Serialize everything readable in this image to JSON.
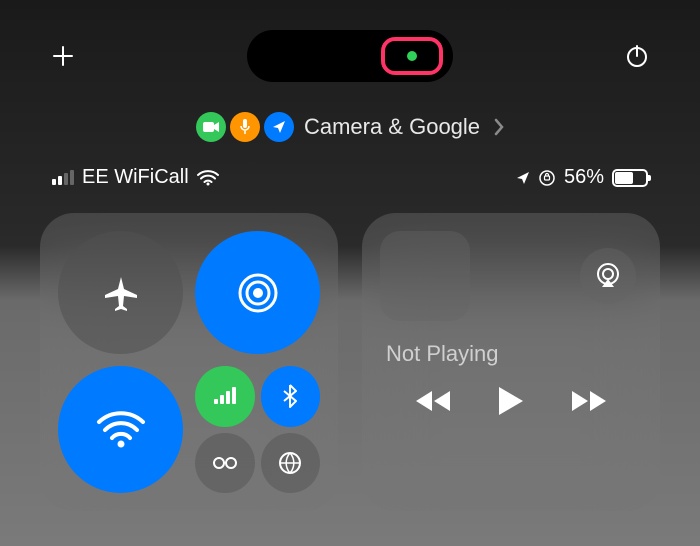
{
  "top": {
    "privacy_highlight_color": "#ff3366"
  },
  "privacy": {
    "label": "Camera & Google"
  },
  "status": {
    "carrier": "EE WiFiCall",
    "battery_percent": "56%"
  },
  "media": {
    "label": "Not Playing"
  },
  "colors": {
    "accent_blue": "#007aff",
    "accent_green": "#34c759",
    "accent_orange": "#ff9500"
  }
}
